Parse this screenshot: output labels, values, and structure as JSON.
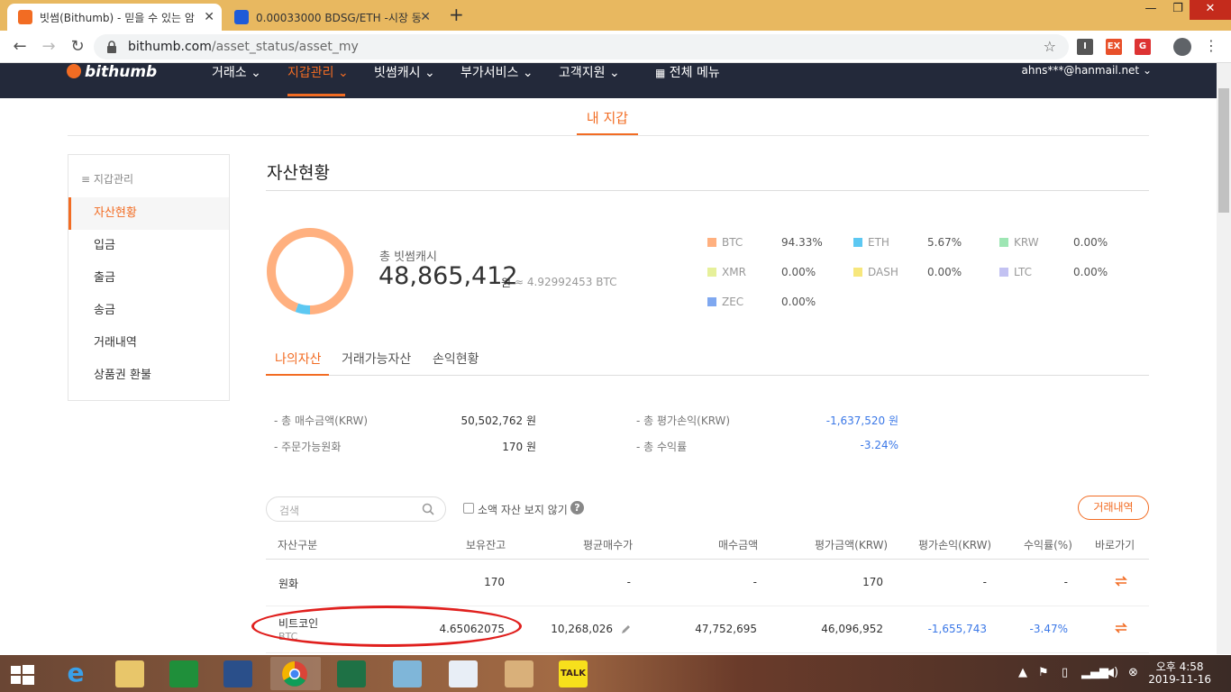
{
  "browser": {
    "tabs": [
      {
        "title": "빗썸(Bithumb) - 믿을 수 있는 암",
        "active": true
      },
      {
        "title": "0.00033000 BDSG/ETH -시장 동",
        "active": false
      }
    ],
    "new_tab": "+",
    "url_host": "bithumb.com",
    "url_path": "/asset_status/asset_my",
    "window_controls": {
      "minimize": "—",
      "maximize": "❐",
      "close": "✕"
    }
  },
  "site": {
    "logo": "bithumb",
    "nav": [
      {
        "label": "거래소 ⌄",
        "active": false
      },
      {
        "label": "지갑관리 ⌄",
        "active": true
      },
      {
        "label": "빗썸캐시 ⌄",
        "active": false
      },
      {
        "label": "부가서비스 ⌄",
        "active": false
      },
      {
        "label": "고객지원 ⌄",
        "active": false
      },
      {
        "label": "전체 메뉴",
        "active": false
      }
    ],
    "account": "ahns***@hanmail.net ⌄"
  },
  "page": {
    "tab_title": "내 지갑",
    "sidebar": {
      "title": "지갑관리",
      "items": [
        "자산현황",
        "입금",
        "출금",
        "송금",
        "거래내역",
        "상품권 환불"
      ],
      "active_index": 0
    },
    "section_title": "자산현황",
    "total": {
      "label": "총 빗썸캐시",
      "value": "48,865,412",
      "unit": "원",
      "btc": "≈ 4.92992453 BTC"
    },
    "allocation": [
      {
        "name": "BTC",
        "pct": "94.33%",
        "color": "#ffb07f",
        "share": 94.33
      },
      {
        "name": "ETH",
        "pct": "5.67%",
        "color": "#5cc8f2",
        "share": 5.67
      },
      {
        "name": "KRW",
        "pct": "0.00%",
        "color": "#9ee6b4",
        "share": 0
      },
      {
        "name": "XMR",
        "pct": "0.00%",
        "color": "#e6f09a",
        "share": 0
      },
      {
        "name": "DASH",
        "pct": "0.00%",
        "color": "#f7e77c",
        "share": 0
      },
      {
        "name": "LTC",
        "pct": "0.00%",
        "color": "#c3c2f2",
        "share": 0
      },
      {
        "name": "ZEC",
        "pct": "0.00%",
        "color": "#7fa8f0",
        "share": 0
      }
    ],
    "subtabs": [
      "나의자산",
      "거래가능자산",
      "손익현황"
    ],
    "summary": {
      "buy_total_label": "- 총 매수금액(KRW)",
      "buy_total": "50,502,762 원",
      "orderable_label": "- 주문가능원화",
      "orderable": "170 원",
      "eval_pl_label": "- 총 평가손익(KRW)",
      "eval_pl": "-1,637,520 원",
      "return_label": "- 총 수익률",
      "return": "-3.24%"
    },
    "search_placeholder": "검색",
    "hide_small_label": "소액 자산 보지 않기",
    "help": "?",
    "history_button": "거래내역",
    "table": {
      "headers": [
        "자산구분",
        "보유잔고",
        "평균매수가",
        "매수금액",
        "평가금액(KRW)",
        "평가손익(KRW)",
        "수익률(%)",
        "바로가기"
      ],
      "rows": [
        {
          "name": "원화",
          "sub": "",
          "balance": "170",
          "avg": "-",
          "buy": "-",
          "eval": "170",
          "pl": "-",
          "ret": "-"
        },
        {
          "name": "비트코인",
          "sub": "BTC",
          "balance": "4.65062075",
          "avg": "10,268,026",
          "buy": "47,752,695",
          "eval": "46,096,952",
          "pl": "-1,655,743",
          "ret": "-3.47%"
        }
      ]
    }
  },
  "taskbar": {
    "clock_time": "오후 4:58",
    "clock_date": "2019-11-16",
    "kakao": "TALK"
  }
}
